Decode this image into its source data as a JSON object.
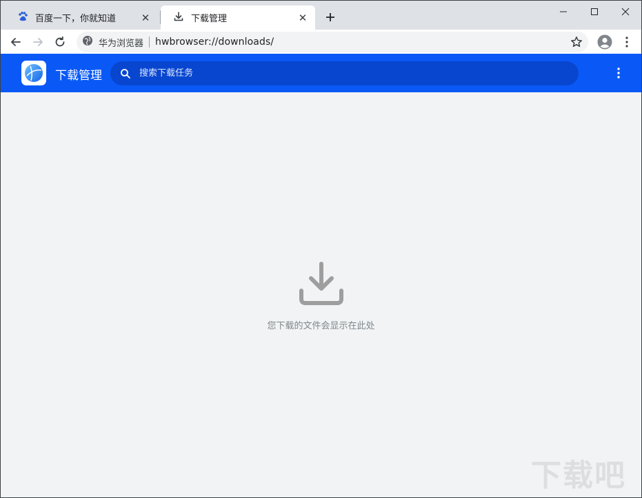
{
  "tabs": [
    {
      "title": "百度一下，你就知道",
      "icon": "baidu-paw-icon",
      "active": false
    },
    {
      "title": "下载管理",
      "icon": "download-icon",
      "active": true
    }
  ],
  "window_controls": {
    "minimize": "minimize-icon",
    "maximize": "maximize-icon",
    "close": "close-icon"
  },
  "toolbar": {
    "site_name": "华为浏览器",
    "url": "hwbrowser://downloads/"
  },
  "app": {
    "title": "下载管理",
    "search_placeholder": "搜索下载任务",
    "accent_color": "#0a59f7"
  },
  "empty_state": {
    "message": "您下载的文件会显示在此处"
  },
  "watermark": "下载吧"
}
